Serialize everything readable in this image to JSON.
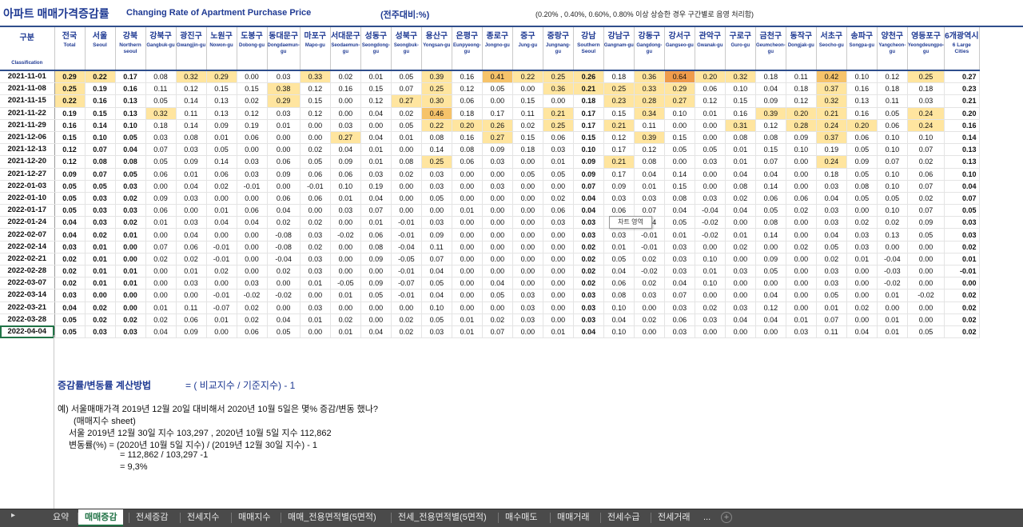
{
  "header": {
    "title_ko": "아파트 매매가격증감률",
    "title_en": "Changing Rate of Apartment Purchase Price",
    "basis": "(전주대비:%)",
    "note": "(0.20% , 0.40%, 0.60%, 0.80% 이상 상승한 경우 구간별로 음영 처리함)"
  },
  "columns": [
    {
      "ko": "구분",
      "en": "Classification"
    },
    {
      "ko": "전국",
      "en": "Total"
    },
    {
      "ko": "서울",
      "en": "Seoul"
    },
    {
      "ko": "강북",
      "en": "Northern seoul"
    },
    {
      "ko": "강북구",
      "en": "Gangbuk-gu"
    },
    {
      "ko": "광진구",
      "en": "Gwangjin-gu"
    },
    {
      "ko": "노원구",
      "en": "Nowon-gu"
    },
    {
      "ko": "도봉구",
      "en": "Dobong-gu"
    },
    {
      "ko": "동대문구",
      "en": "Dongdaemun-gu"
    },
    {
      "ko": "마포구",
      "en": "Mapo-gu"
    },
    {
      "ko": "서대문구",
      "en": "Seodaemun-gu"
    },
    {
      "ko": "성동구",
      "en": "Seongdong-gu"
    },
    {
      "ko": "성북구",
      "en": "Seongbuk-gu"
    },
    {
      "ko": "용산구",
      "en": "Yongsan-gu"
    },
    {
      "ko": "은평구",
      "en": "Eunpyeong-gu"
    },
    {
      "ko": "종로구",
      "en": "Jongno-gu"
    },
    {
      "ko": "중구",
      "en": "Jung-gu"
    },
    {
      "ko": "중랑구",
      "en": "Jungnang-gu"
    },
    {
      "ko": "강남",
      "en": "Southern Seoul"
    },
    {
      "ko": "강남구",
      "en": "Gangnam-gu"
    },
    {
      "ko": "강동구",
      "en": "Gangdong-gu"
    },
    {
      "ko": "강서구",
      "en": "Gangseo-gu"
    },
    {
      "ko": "관악구",
      "en": "Gwanak-gu"
    },
    {
      "ko": "구로구",
      "en": "Guro-gu"
    },
    {
      "ko": "금천구",
      "en": "Geumcheon-gu"
    },
    {
      "ko": "동작구",
      "en": "Dongjak-gu"
    },
    {
      "ko": "서초구",
      "en": "Seocho-gu"
    },
    {
      "ko": "송파구",
      "en": "Songpa-gu"
    },
    {
      "ko": "양천구",
      "en": "Yangcheon-gu"
    },
    {
      "ko": "영등포구",
      "en": "Yeongdeungpo-gu"
    },
    {
      "ko": "6개광역시",
      "en": "6 Large Cities"
    }
  ],
  "rows": [
    [
      "2021-11-01",
      "0.29",
      "0.22",
      "0.17",
      "0.08",
      "0.32",
      "0.29",
      "0.00",
      "0.03",
      "0.33",
      "0.02",
      "0.01",
      "0.05",
      "0.39",
      "0.16",
      "0.41",
      "0.22",
      "0.25",
      "0.26",
      "0.18",
      "0.36",
      "0.64",
      "0.20",
      "0.32",
      "0.18",
      "0.11",
      "0.42",
      "0.10",
      "0.12",
      "0.25",
      "0.27"
    ],
    [
      "2021-11-08",
      "0.25",
      "0.19",
      "0.16",
      "0.11",
      "0.12",
      "0.15",
      "0.15",
      "0.38",
      "0.12",
      "0.16",
      "0.15",
      "0.07",
      "0.25",
      "0.12",
      "0.05",
      "0.00",
      "0.36",
      "0.21",
      "0.25",
      "0.33",
      "0.29",
      "0.06",
      "0.10",
      "0.04",
      "0.18",
      "0.37",
      "0.16",
      "0.18",
      "0.18",
      "0.23"
    ],
    [
      "2021-11-15",
      "0.22",
      "0.16",
      "0.13",
      "0.05",
      "0.14",
      "0.13",
      "0.02",
      "0.29",
      "0.15",
      "0.00",
      "0.12",
      "0.27",
      "0.30",
      "0.06",
      "0.00",
      "0.15",
      "0.00",
      "0.18",
      "0.23",
      "0.28",
      "0.27",
      "0.12",
      "0.15",
      "0.09",
      "0.12",
      "0.32",
      "0.13",
      "0.11",
      "0.03",
      "0.21"
    ],
    [
      "2021-11-22",
      "0.19",
      "0.15",
      "0.13",
      "0.32",
      "0.11",
      "0.13",
      "0.12",
      "0.03",
      "0.12",
      "0.00",
      "0.04",
      "0.02",
      "0.46",
      "0.18",
      "0.17",
      "0.11",
      "0.21",
      "0.17",
      "0.15",
      "0.34",
      "0.10",
      "0.01",
      "0.16",
      "0.39",
      "0.20",
      "0.21",
      "0.16",
      "0.05",
      "0.24",
      "0.20"
    ],
    [
      "2021-11-29",
      "0.16",
      "0.14",
      "0.10",
      "0.18",
      "0.14",
      "0.09",
      "0.19",
      "0.01",
      "0.00",
      "0.03",
      "0.00",
      "0.05",
      "0.22",
      "0.20",
      "0.26",
      "0.02",
      "0.25",
      "0.17",
      "0.21",
      "0.11",
      "0.00",
      "0.00",
      "0.31",
      "0.12",
      "0.28",
      "0.24",
      "0.20",
      "0.06",
      "0.24",
      "0.16"
    ],
    [
      "2021-12-06",
      "0.15",
      "0.10",
      "0.05",
      "0.03",
      "0.08",
      "0.01",
      "0.06",
      "0.00",
      "0.00",
      "0.27",
      "0.04",
      "0.01",
      "0.08",
      "0.16",
      "0.27",
      "0.15",
      "0.06",
      "0.15",
      "0.12",
      "0.39",
      "0.15",
      "0.00",
      "0.08",
      "0.08",
      "0.09",
      "0.37",
      "0.06",
      "0.10",
      "0.10",
      "0.14"
    ],
    [
      "2021-12-13",
      "0.12",
      "0.07",
      "0.04",
      "0.07",
      "0.03",
      "0.05",
      "0.00",
      "0.00",
      "0.02",
      "0.04",
      "0.01",
      "0.00",
      "0.14",
      "0.08",
      "0.09",
      "0.18",
      "0.03",
      "0.10",
      "0.17",
      "0.12",
      "0.05",
      "0.05",
      "0.01",
      "0.15",
      "0.10",
      "0.19",
      "0.05",
      "0.10",
      "0.07",
      "0.13"
    ],
    [
      "2021-12-20",
      "0.12",
      "0.08",
      "0.08",
      "0.05",
      "0.09",
      "0.14",
      "0.03",
      "0.06",
      "0.05",
      "0.09",
      "0.01",
      "0.08",
      "0.25",
      "0.06",
      "0.03",
      "0.00",
      "0.01",
      "0.09",
      "0.21",
      "0.08",
      "0.00",
      "0.03",
      "0.01",
      "0.07",
      "0.00",
      "0.24",
      "0.09",
      "0.07",
      "0.02",
      "0.13"
    ],
    [
      "2021-12-27",
      "0.09",
      "0.07",
      "0.05",
      "0.06",
      "0.01",
      "0.06",
      "0.03",
      "0.09",
      "0.06",
      "0.06",
      "0.03",
      "0.02",
      "0.03",
      "0.00",
      "0.00",
      "0.05",
      "0.05",
      "0.09",
      "0.17",
      "0.04",
      "0.14",
      "0.00",
      "0.04",
      "0.04",
      "0.00",
      "0.18",
      "0.05",
      "0.10",
      "0.06",
      "0.10"
    ],
    [
      "2022-01-03",
      "0.05",
      "0.05",
      "0.03",
      "0.00",
      "0.04",
      "0.02",
      "-0.01",
      "0.00",
      "-0.01",
      "0.10",
      "0.19",
      "0.00",
      "0.03",
      "0.00",
      "0.03",
      "0.00",
      "0.00",
      "0.07",
      "0.09",
      "0.01",
      "0.15",
      "0.00",
      "0.08",
      "0.14",
      "0.00",
      "0.03",
      "0.08",
      "0.10",
      "0.07",
      "0.04"
    ],
    [
      "2022-01-10",
      "0.05",
      "0.03",
      "0.02",
      "0.09",
      "0.03",
      "0.00",
      "0.00",
      "0.06",
      "0.06",
      "0.01",
      "0.04",
      "0.00",
      "0.05",
      "0.00",
      "0.00",
      "0.00",
      "0.02",
      "0.04",
      "0.03",
      "0.03",
      "0.08",
      "0.03",
      "0.02",
      "0.06",
      "0.06",
      "0.04",
      "0.05",
      "0.05",
      "0.02",
      "0.07"
    ],
    [
      "2022-01-17",
      "0.05",
      "0.03",
      "0.03",
      "0.06",
      "0.00",
      "0.01",
      "0.06",
      "0.04",
      "0.00",
      "0.03",
      "0.07",
      "0.00",
      "0.00",
      "0.01",
      "0.00",
      "0.00",
      "0.06",
      "0.04",
      "0.06",
      "0.07",
      "0.04",
      "-0.04",
      "0.04",
      "0.05",
      "0.02",
      "0.03",
      "0.00",
      "0.10",
      "0.07",
      "0.05"
    ],
    [
      "2022-01-24",
      "0.04",
      "0.03",
      "0.02",
      "0.01",
      "0.03",
      "0.04",
      "0.04",
      "0.02",
      "0.02",
      "0.00",
      "0.01",
      "-0.01",
      "0.03",
      "0.00",
      "0.00",
      "0.00",
      "0.03",
      "0.03",
      "0.06",
      "0.04",
      "0.05",
      "-0.02",
      "0.00",
      "0.08",
      "0.00",
      "0.03",
      "0.02",
      "0.02",
      "0.09",
      "0.03"
    ],
    [
      "2022-02-07",
      "0.04",
      "0.02",
      "0.01",
      "0.00",
      "0.04",
      "0.00",
      "0.00",
      "-0.08",
      "0.03",
      "-0.02",
      "0.06",
      "-0.01",
      "0.09",
      "0.00",
      "0.00",
      "0.00",
      "0.00",
      "0.03",
      "0.03",
      "-0.01",
      "0.01",
      "-0.02",
      "0.01",
      "0.14",
      "0.00",
      "0.04",
      "0.03",
      "0.13",
      "0.05",
      "0.03"
    ],
    [
      "2022-02-14",
      "0.03",
      "0.01",
      "0.00",
      "0.07",
      "0.06",
      "-0.01",
      "0.00",
      "-0.08",
      "0.02",
      "0.00",
      "0.08",
      "-0.04",
      "0.11",
      "0.00",
      "0.00",
      "0.00",
      "0.00",
      "0.02",
      "0.01",
      "-0.01",
      "0.03",
      "0.00",
      "0.02",
      "0.00",
      "0.02",
      "0.05",
      "0.03",
      "0.00",
      "0.00",
      "0.02"
    ],
    [
      "2022-02-21",
      "0.02",
      "0.01",
      "0.00",
      "0.02",
      "0.02",
      "-0.01",
      "0.00",
      "-0.04",
      "0.03",
      "0.00",
      "0.09",
      "-0.05",
      "0.07",
      "0.00",
      "0.00",
      "0.00",
      "0.00",
      "0.02",
      "0.05",
      "0.02",
      "0.03",
      "0.10",
      "0.00",
      "0.09",
      "0.00",
      "0.02",
      "0.01",
      "-0.04",
      "0.00",
      "0.01"
    ],
    [
      "2022-02-28",
      "0.02",
      "0.01",
      "0.01",
      "0.00",
      "0.01",
      "0.02",
      "0.00",
      "0.02",
      "0.03",
      "0.00",
      "0.00",
      "-0.01",
      "0.04",
      "0.00",
      "0.00",
      "0.00",
      "0.00",
      "0.02",
      "0.04",
      "-0.02",
      "0.03",
      "0.01",
      "0.03",
      "0.05",
      "0.00",
      "0.03",
      "0.00",
      "-0.03",
      "0.00",
      "-0.01"
    ],
    [
      "2022-03-07",
      "0.02",
      "0.01",
      "0.01",
      "0.00",
      "0.03",
      "0.00",
      "0.03",
      "0.00",
      "0.01",
      "-0.05",
      "0.09",
      "-0.07",
      "0.05",
      "0.00",
      "0.04",
      "0.00",
      "0.00",
      "0.02",
      "0.06",
      "0.02",
      "0.04",
      "0.10",
      "0.00",
      "0.00",
      "0.00",
      "0.03",
      "0.00",
      "-0.02",
      "0.00",
      "0.00"
    ],
    [
      "2022-03-14",
      "0.03",
      "0.00",
      "0.00",
      "0.00",
      "0.00",
      "-0.01",
      "-0.02",
      "-0.02",
      "0.00",
      "0.01",
      "0.05",
      "-0.01",
      "0.04",
      "0.00",
      "0.05",
      "0.03",
      "0.00",
      "0.03",
      "0.08",
      "0.03",
      "0.07",
      "0.00",
      "0.00",
      "0.04",
      "0.00",
      "0.05",
      "0.00",
      "0.01",
      "-0.02",
      "0.02"
    ],
    [
      "2022-03-21",
      "0.04",
      "0.02",
      "0.00",
      "0.01",
      "0.11",
      "-0.07",
      "0.02",
      "0.00",
      "0.03",
      "0.00",
      "0.00",
      "0.00",
      "0.10",
      "0.00",
      "0.00",
      "0.03",
      "0.00",
      "0.03",
      "0.10",
      "0.00",
      "0.03",
      "0.02",
      "0.03",
      "0.12",
      "0.00",
      "0.01",
      "0.02",
      "0.00",
      "0.00",
      "0.02"
    ],
    [
      "2022-03-28",
      "0.05",
      "0.02",
      "0.02",
      "0.02",
      "0.06",
      "0.01",
      "0.02",
      "0.04",
      "0.01",
      "0.02",
      "0.00",
      "0.02",
      "0.05",
      "0.01",
      "0.02",
      "0.03",
      "0.00",
      "0.03",
      "0.04",
      "0.02",
      "0.06",
      "0.03",
      "0.04",
      "0.04",
      "0.01",
      "0.07",
      "0.00",
      "0.01",
      "0.00",
      "0.02"
    ],
    [
      "2022-04-04",
      "0.05",
      "0.03",
      "0.03",
      "0.04",
      "0.09",
      "0.00",
      "0.06",
      "0.05",
      "0.00",
      "0.01",
      "0.04",
      "0.02",
      "0.03",
      "0.01",
      "0.07",
      "0.00",
      "0.01",
      "0.04",
      "0.10",
      "0.00",
      "0.03",
      "0.00",
      "0.00",
      "0.00",
      "0.03",
      "0.11",
      "0.04",
      "0.01",
      "0.05",
      "0.02"
    ]
  ],
  "tooltip": "차트 영역",
  "formula": {
    "title": "증감률/변동률 계산방법",
    "equation": "= ( 비교지수 / 기준지수) - 1"
  },
  "example": {
    "line1": "예) 서울매매가격 2019년 12월 20일 대비해서 2020년 10월 5일은 몇% 증감/변동 했나?",
    "line2": "(매매지수 sheet)",
    "line3": "서울 2019년 12월 30일 지수 103,297 , 2020년 10월 5일 지수 112,862",
    "line4": "변동률(%) = (2020년 10월 5일 지수) / (2019년 12월 30일 지수) - 1",
    "line5": "= 112,862 / 103,297 -1",
    "line6": "= 9,3%"
  },
  "tabs": [
    "요약",
    "매매증감",
    "전세증감",
    "전세지수",
    "매매지수",
    "매매_전용면적별(5면적)",
    "전세_전용면적별(5면적)",
    "매수매도",
    "매매거래",
    "전세수급",
    "전세거래"
  ],
  "active_tab": "매매증감",
  "tab_more": "...",
  "tab_add": "+",
  "tab_scroll": "▸",
  "colors": {
    "header_text": "#1f3a93",
    "shade_020": "#ffe59f",
    "shade_040": "#f6c36a",
    "shade_060": "#ef9b4b",
    "tab_active": "#217346"
  }
}
